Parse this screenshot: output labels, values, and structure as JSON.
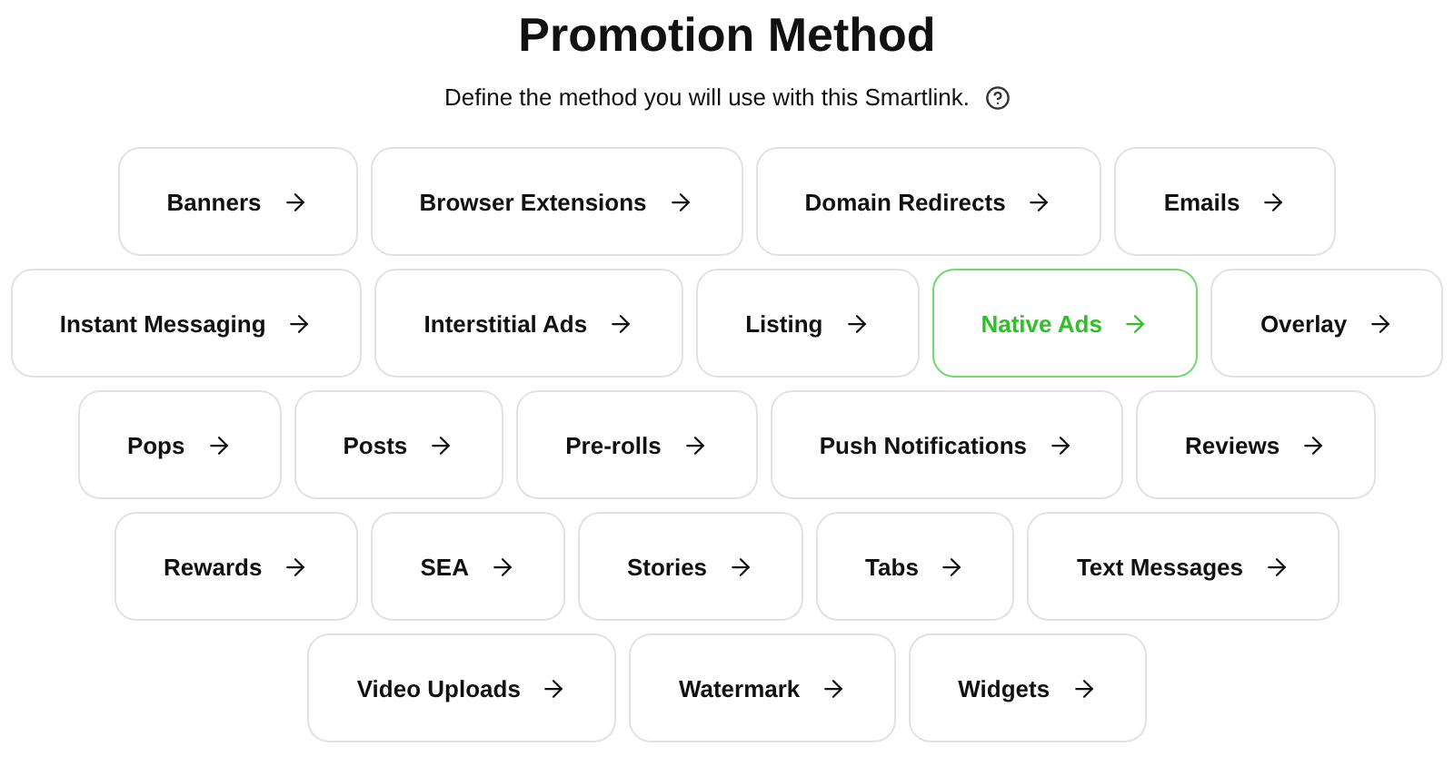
{
  "title": "Promotion Method",
  "subtitle": "Define the method you will use with this Smartlink.",
  "rows": [
    [
      {
        "label": "Banners",
        "selected": false
      },
      {
        "label": "Browser Extensions",
        "selected": false
      },
      {
        "label": "Domain Redirects",
        "selected": false
      },
      {
        "label": "Emails",
        "selected": false
      }
    ],
    [
      {
        "label": "Instant Messaging",
        "selected": false
      },
      {
        "label": "Interstitial Ads",
        "selected": false
      },
      {
        "label": "Listing",
        "selected": false
      },
      {
        "label": "Native Ads",
        "selected": true
      },
      {
        "label": "Overlay",
        "selected": false
      }
    ],
    [
      {
        "label": "Pops",
        "selected": false
      },
      {
        "label": "Posts",
        "selected": false
      },
      {
        "label": "Pre-rolls",
        "selected": false
      },
      {
        "label": "Push Notifications",
        "selected": false
      },
      {
        "label": "Reviews",
        "selected": false
      }
    ],
    [
      {
        "label": "Rewards",
        "selected": false
      },
      {
        "label": "SEA",
        "selected": false
      },
      {
        "label": "Stories",
        "selected": false
      },
      {
        "label": "Tabs",
        "selected": false
      },
      {
        "label": "Text Messages",
        "selected": false
      }
    ],
    [
      {
        "label": "Video Uploads",
        "selected": false
      },
      {
        "label": "Watermark",
        "selected": false
      },
      {
        "label": "Widgets",
        "selected": false
      }
    ]
  ]
}
